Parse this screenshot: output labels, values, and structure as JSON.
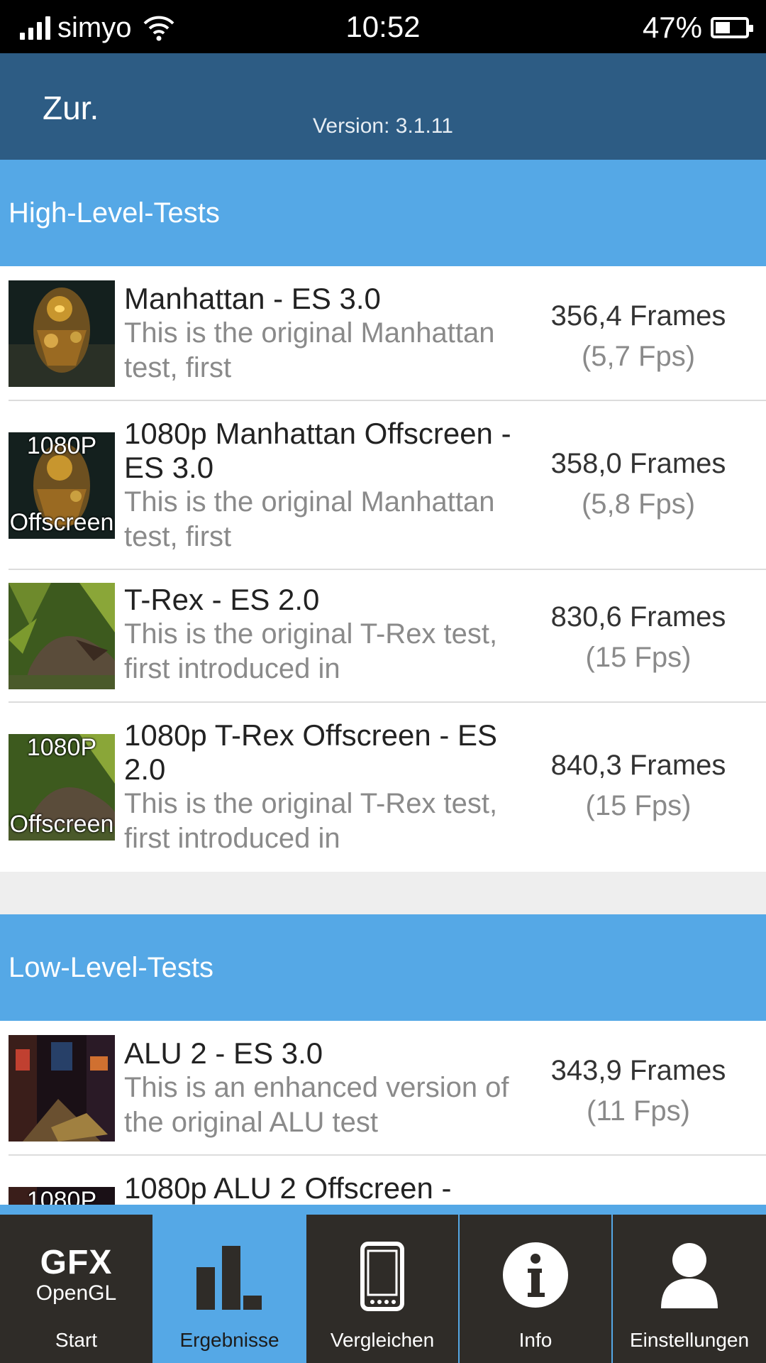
{
  "status_bar": {
    "carrier": "simyo",
    "time": "10:52",
    "battery_percent": "47%"
  },
  "header": {
    "back_label": "Zur.",
    "version": "Version: 3.1.11"
  },
  "sections": [
    {
      "title": "High-Level-Tests",
      "tests": [
        {
          "title": "Manhattan - ES 3.0",
          "description": "This is the original Manhattan test, first",
          "frames": "356,4 Frames",
          "fps": "(5,7 Fps)",
          "thumb_icon": "manhattan-thumbnail",
          "overlay_top": "",
          "overlay_bottom": ""
        },
        {
          "title": "1080p Manhattan Offscreen - ES 3.0",
          "description": "This is the original Manhattan test, first",
          "frames": "358,0 Frames",
          "fps": "(5,8 Fps)",
          "thumb_icon": "manhattan-offscreen-thumbnail",
          "overlay_top": "1080P",
          "overlay_bottom": "Offscreen"
        },
        {
          "title": "T-Rex - ES 2.0",
          "description": "This is the original T-Rex test, first introduced in",
          "frames": "830,6 Frames",
          "fps": "(15 Fps)",
          "thumb_icon": "trex-thumbnail",
          "overlay_top": "",
          "overlay_bottom": ""
        },
        {
          "title": "1080p T-Rex Offscreen - ES 2.0",
          "description": "This is the original T-Rex test, first introduced in",
          "frames": "840,3 Frames",
          "fps": "(15 Fps)",
          "thumb_icon": "trex-offscreen-thumbnail",
          "overlay_top": "1080P",
          "overlay_bottom": "Offscreen"
        }
      ]
    },
    {
      "title": "Low-Level-Tests",
      "tests": [
        {
          "title": "ALU 2 - ES 3.0",
          "description": "This is an enhanced version of the original ALU test",
          "frames": "343,9 Frames",
          "fps": "(11 Fps)",
          "thumb_icon": "alu-thumbnail",
          "overlay_top": "",
          "overlay_bottom": ""
        },
        {
          "title": "1080p ALU 2 Offscreen -",
          "description": "",
          "frames": "",
          "fps": "",
          "thumb_icon": "alu-offscreen-thumbnail",
          "overlay_top": "1080P",
          "overlay_bottom": ""
        }
      ]
    }
  ],
  "bottom_nav": [
    {
      "label": "Start",
      "icon": "gfx-opengl-logo",
      "logo_top": "GFX",
      "logo_bottom": "OpenGL",
      "active": false
    },
    {
      "label": "Ergebnisse",
      "icon": "bar-chart-icon",
      "active": true
    },
    {
      "label": "Vergleichen",
      "icon": "smartphone-icon",
      "active": false
    },
    {
      "label": "Info",
      "icon": "info-icon",
      "active": false
    },
    {
      "label": "Einstellungen",
      "icon": "user-icon",
      "active": false
    }
  ],
  "colors": {
    "status_bar": "#000000",
    "header": "#2d5c84",
    "section": "#55a8e6",
    "nav_bg": "#2f2c28",
    "nav_active": "#55a8e6"
  }
}
